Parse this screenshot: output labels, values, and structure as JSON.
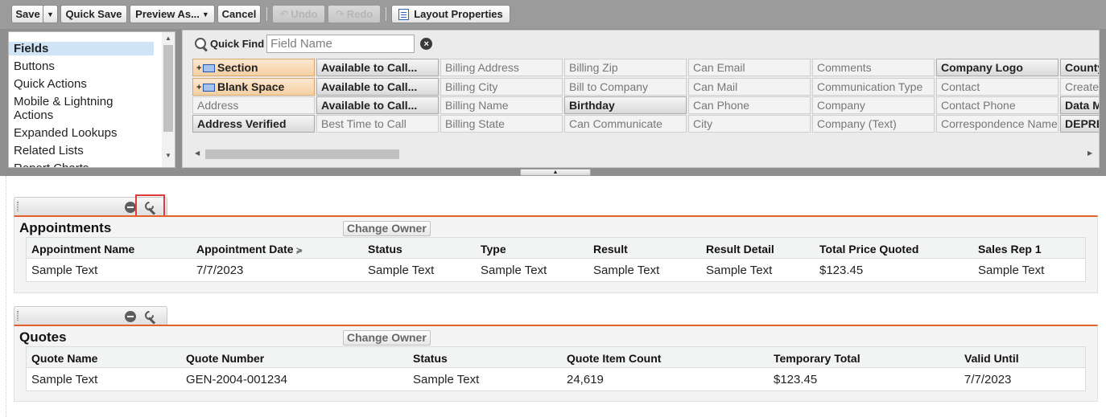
{
  "toolbar": {
    "save": "Save",
    "quick_save": "Quick Save",
    "preview_as": "Preview As...",
    "cancel": "Cancel",
    "undo": "Undo",
    "redo": "Redo",
    "layout_properties": "Layout Properties"
  },
  "categories": {
    "items": [
      "Fields",
      "Buttons",
      "Quick Actions",
      "Mobile & Lightning Actions",
      "Expanded Lookups",
      "Related Lists",
      "Report Charts"
    ],
    "selected": "Fields"
  },
  "quick_find": {
    "label": "Quick Find",
    "placeholder": "Field Name"
  },
  "fields": {
    "rows": [
      [
        "Section",
        "Available to Call...",
        "Billing Address",
        "Billing Zip",
        "Can Email",
        "Comments",
        "Company Logo",
        "County"
      ],
      [
        "Blank Space",
        "Available to Call...",
        "Billing City",
        "Bill to Company",
        "Can Mail",
        "Communication Type",
        "Contact",
        "Created"
      ],
      [
        "Address",
        "Available to Call...",
        "Billing Name",
        "Birthday",
        "Can Phone",
        "Company",
        "Contact Phone",
        "Data M"
      ],
      [
        "Address Verified",
        "Best Time to Call",
        "Billing State",
        "Can Communicate",
        "City",
        "Company (Text)",
        "Correspondence Name",
        "DEPRE"
      ]
    ]
  },
  "appointments": {
    "title": "Appointments",
    "change_owner": "Change Owner",
    "columns": [
      "Appointment Name",
      "Appointment Date",
      "Status",
      "Type",
      "Result",
      "Result Detail",
      "Total Price Quoted",
      "Sales Rep 1"
    ],
    "row": [
      "Sample Text",
      "7/7/2023",
      "Sample Text",
      "Sample Text",
      "Sample Text",
      "Sample Text",
      "$123.45",
      "Sample Text"
    ]
  },
  "quotes": {
    "title": "Quotes",
    "change_owner": "Change Owner",
    "columns": [
      "Quote Name",
      "Quote Number",
      "Status",
      "Quote Item Count",
      "Temporary Total",
      "Valid Until"
    ],
    "row": [
      "Sample Text",
      "GEN-2004-001234",
      "Sample Text",
      "24,619",
      "$123.45",
      "7/7/2023"
    ]
  },
  "colors": {
    "section_accent": "#e3622c",
    "highlight": "#e03b3b",
    "selected_category": "#cfe4f6"
  }
}
